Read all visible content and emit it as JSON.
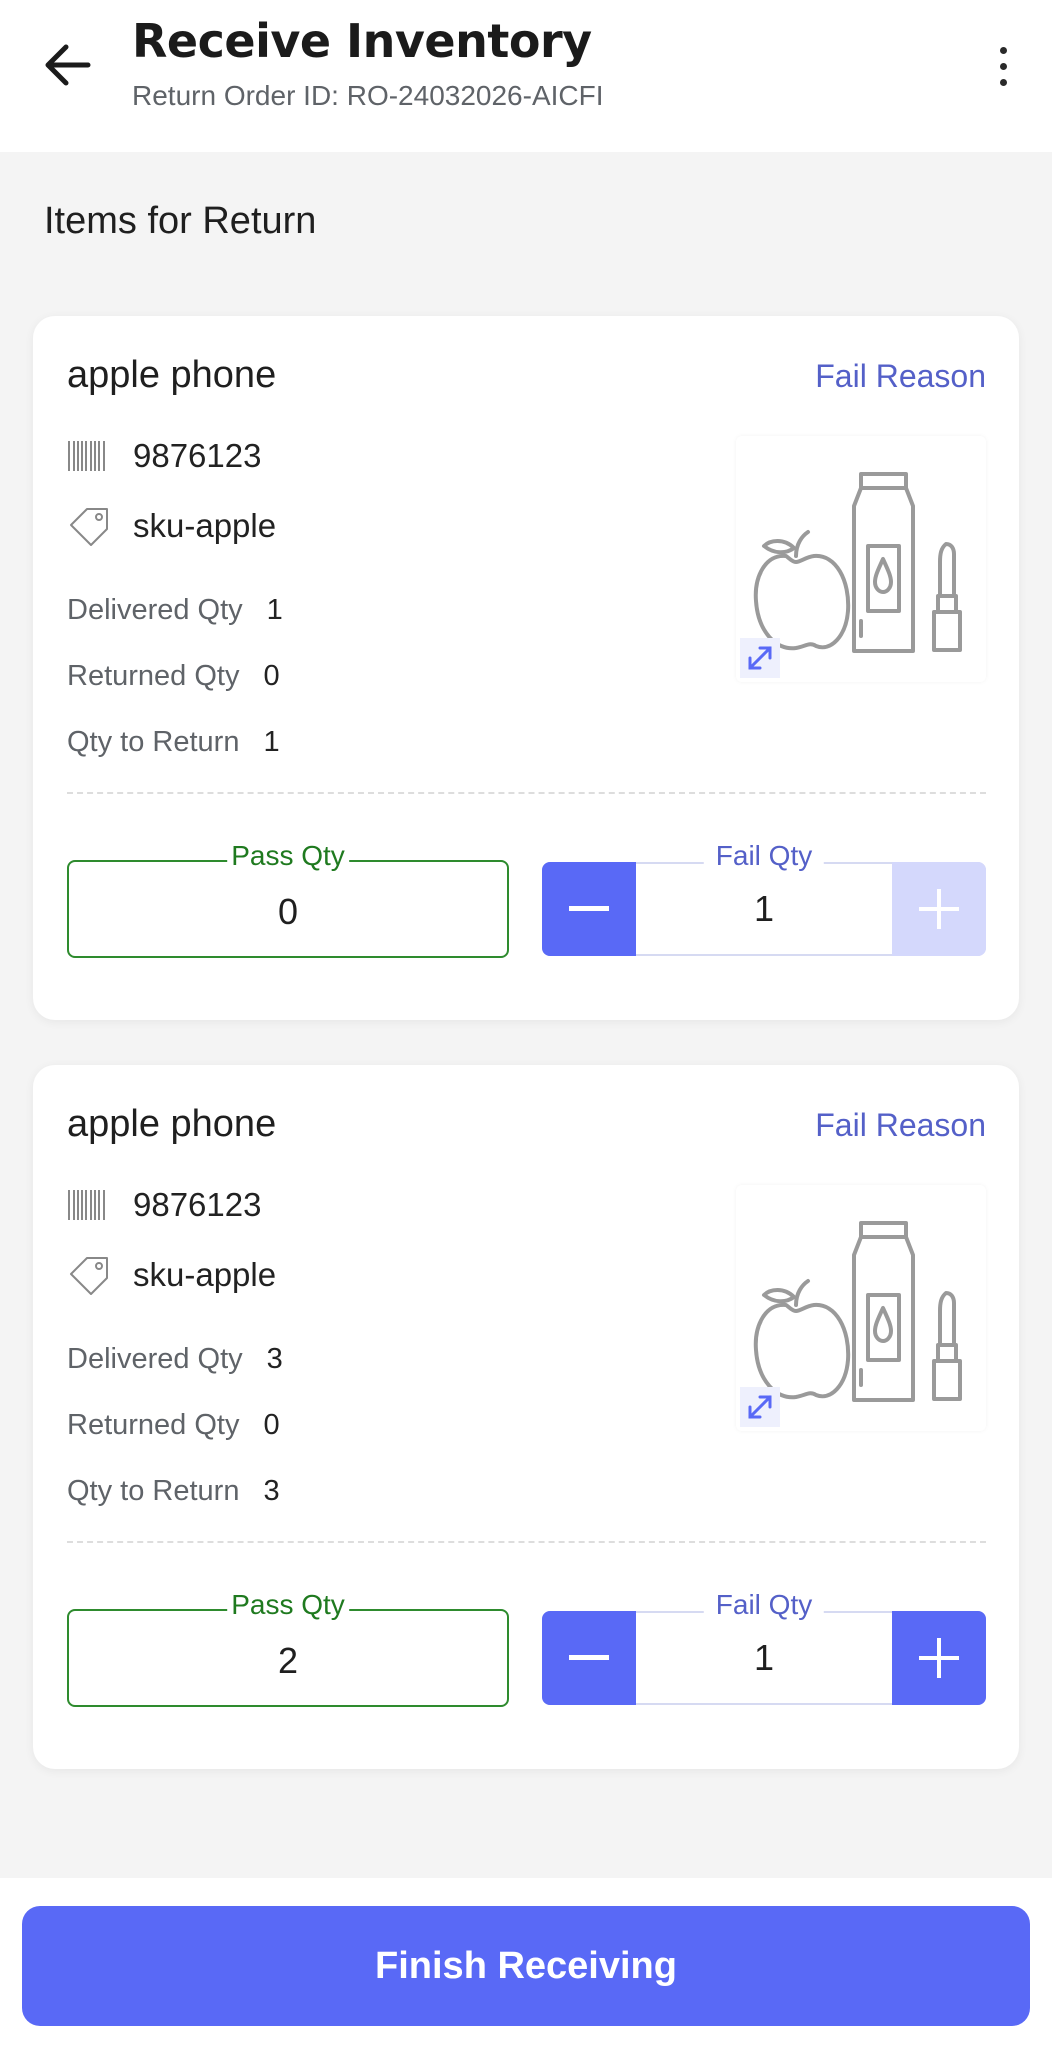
{
  "header": {
    "title": "Receive Inventory",
    "subtitle": "Return Order ID: RO-24032026-AICFI",
    "back_icon": "arrow-left-icon",
    "menu_icon": "more-vertical-icon"
  },
  "section_title": "Items for Return",
  "items": [
    {
      "name": "apple phone",
      "fail_reason_label": "Fail Reason",
      "barcode": "9876123",
      "sku": "sku-apple",
      "delivered_label": "Delivered Qty",
      "delivered": "1",
      "returned_label": "Returned Qty",
      "returned": "0",
      "to_return_label": "Qty to Return",
      "to_return": "1",
      "pass_label": "Pass Qty",
      "pass_qty": "0",
      "fail_label": "Fail Qty",
      "fail_qty": "1",
      "plus_enabled": false
    },
    {
      "name": "apple phone",
      "fail_reason_label": "Fail Reason",
      "barcode": "9876123",
      "sku": "sku-apple",
      "delivered_label": "Delivered Qty",
      "delivered": "3",
      "returned_label": "Returned Qty",
      "returned": "0",
      "to_return_label": "Qty to Return",
      "to_return": "3",
      "pass_label": "Pass Qty",
      "pass_qty": "2",
      "fail_label": "Fail Qty",
      "fail_qty": "1",
      "plus_enabled": true
    }
  ],
  "footer": {
    "finish_label": "Finish Receiving"
  },
  "colors": {
    "accent": "#5969f6",
    "pass_green": "#2e8b2e",
    "link_blue": "#5460c8"
  }
}
